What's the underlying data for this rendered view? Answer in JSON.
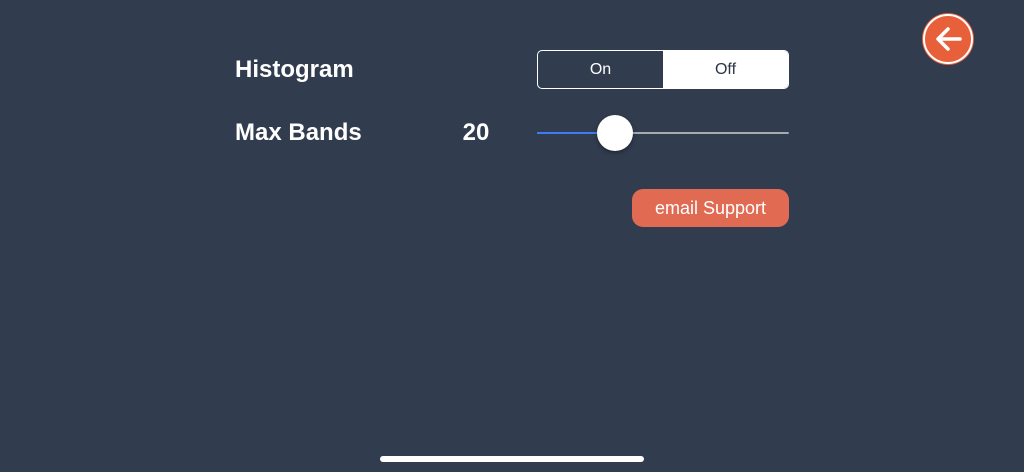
{
  "header": {
    "back_icon": "arrow-left-icon",
    "accent_color": "#e8603a"
  },
  "histogram": {
    "label": "Histogram",
    "options": [
      "On",
      "Off"
    ],
    "selected": "Off"
  },
  "max_bands": {
    "label": "Max Bands",
    "value": "20",
    "slider_fraction": 0.28
  },
  "support": {
    "button_label": "email Support",
    "color": "#e16a52"
  },
  "colors": {
    "background": "#313c4e",
    "slider_fill": "#3f7bf2"
  }
}
